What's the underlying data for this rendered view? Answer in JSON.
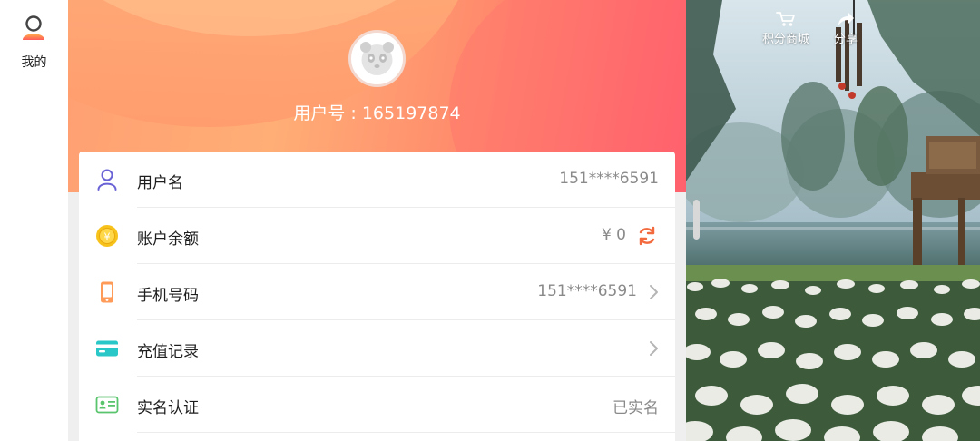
{
  "nav": {
    "items": [
      {
        "label": "我的",
        "icon": "user-profile-icon",
        "active": true
      }
    ]
  },
  "profile": {
    "user_id_text": "用户号 : 165197874",
    "avatar_icon": "panda-avatar-icon"
  },
  "account_rows": [
    {
      "label": "用户名",
      "value": "151****6591",
      "icon": "person-icon",
      "extra": ""
    },
    {
      "label": "账户余额",
      "value": "¥ 0",
      "icon": "coin-icon",
      "extra": "refresh-icon"
    },
    {
      "label": "手机号码",
      "value": "151****6591",
      "icon": "phone-icon",
      "extra": "chevron-right-icon"
    },
    {
      "label": "充值记录",
      "value": "",
      "icon": "card-icon",
      "extra": "chevron-right-icon"
    },
    {
      "label": "实名认证",
      "value": "已实名",
      "icon": "id-card-icon",
      "extra": ""
    }
  ],
  "scene": {
    "buttons": [
      {
        "label": "积分商城",
        "icon": "cart-icon"
      },
      {
        "label": "分享",
        "icon": "share-icon"
      }
    ]
  },
  "colors": {
    "accent_orange": "#ff8a6c",
    "accent_pink": "#ff5a6e",
    "refresh": "#f46a3f"
  }
}
